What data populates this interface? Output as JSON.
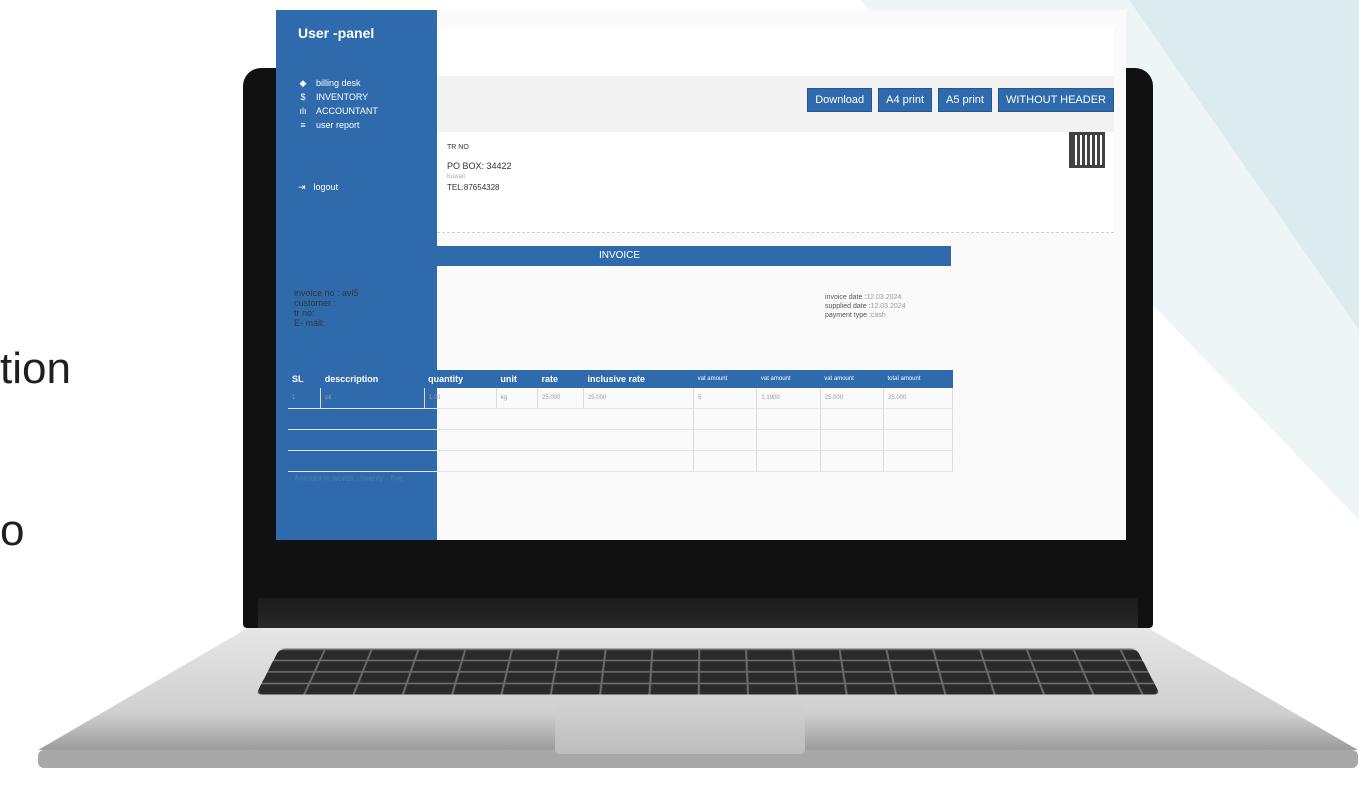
{
  "background_text": {
    "line1": "tion",
    "line2": "o"
  },
  "sidebar": {
    "title": "User -panel",
    "items": [
      {
        "icon": "diamond-icon",
        "label": "billing desk"
      },
      {
        "icon": "dollar-icon",
        "label": "INVENTORY"
      },
      {
        "icon": "chart-icon",
        "label": "ACCOUNTANT"
      },
      {
        "icon": "list-icon",
        "label": "user report"
      }
    ],
    "logout_label": "logout"
  },
  "toolbar": {
    "buttons": [
      "Download",
      "A4 print",
      "A5 print",
      "WITHOUT HEADER"
    ]
  },
  "company": {
    "trn": "TR NO",
    "po_box": "PO BOX: 34422",
    "small": "Kuwait",
    "tel": "TEL:87654328"
  },
  "invoice": {
    "band_title": "INVOICE",
    "left": {
      "invoice_no": "invoice no : avl5",
      "customer": "customer :",
      "tr_no": "tr no:",
      "email": "E- mail:"
    },
    "right": {
      "invoice_date_label": "invoice  date :",
      "invoice_date_value": "12.03.2024",
      "supplied_date_label": "supplied date :",
      "supplied_date_value": "12.03.2024",
      "payment_type_label": "payment type :",
      "payment_type_value": "cash"
    },
    "table": {
      "headers": [
        "SL",
        "desccription",
        "quantity",
        "unit",
        "rate",
        "inclusive rate",
        "vat amount",
        "vat amount",
        "vat amount",
        "total amount"
      ],
      "rows": [
        [
          "1",
          "pll",
          "1.00",
          "kg",
          "25.000",
          "25.000",
          "5",
          "1.1900",
          "25.000",
          "25.000"
        ]
      ]
    },
    "amount_in_words": "Amount in words : twenty - five"
  },
  "colors": {
    "primary": "#2f6bac",
    "background_triangle": "#dcebee"
  }
}
